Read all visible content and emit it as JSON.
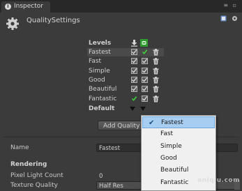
{
  "window": {
    "tab_title": "Inspector",
    "tab_icon": "info-icon",
    "buttons_glyph": "≡ ▫"
  },
  "header": {
    "title": "QualitySettings",
    "icon": "gear-icon"
  },
  "levels": {
    "heading": "Levels",
    "column_icons": [
      "download-icon",
      "android-icon"
    ],
    "rows": [
      {
        "name": "Fastest",
        "checks": [
          true,
          true
        ],
        "col2_color": "#3cd13c"
      },
      {
        "name": "Fast",
        "checks": [
          true,
          true
        ]
      },
      {
        "name": "Simple",
        "checks": [
          true,
          true
        ]
      },
      {
        "name": "Good",
        "checks": [
          true,
          true
        ]
      },
      {
        "name": "Beautiful",
        "checks": [
          true,
          true
        ]
      },
      {
        "name": "Fantastic",
        "checks": [
          true,
          true
        ],
        "col1_color": "#3cd13c"
      }
    ],
    "default_label": "Default",
    "add_button": "Add Quality"
  },
  "dropdown": {
    "selected": "Fastest",
    "options": [
      "Fastest",
      "Fast",
      "Simple",
      "Good",
      "Beautiful",
      "Fantastic"
    ]
  },
  "properties": {
    "name_label": "Name",
    "name_value": "Fastest",
    "rendering_heading": "Rendering",
    "pixel_light_label": "Pixel Light Count",
    "pixel_light_value": "0",
    "texture_quality_label": "Texture Quality",
    "texture_quality_value": "Half Res"
  },
  "watermark": "aniqiu.com",
  "colors": {
    "accent_green": "#3cd13c",
    "selection_blue": "#a7cdf0",
    "bg": "#3b3b3b"
  }
}
